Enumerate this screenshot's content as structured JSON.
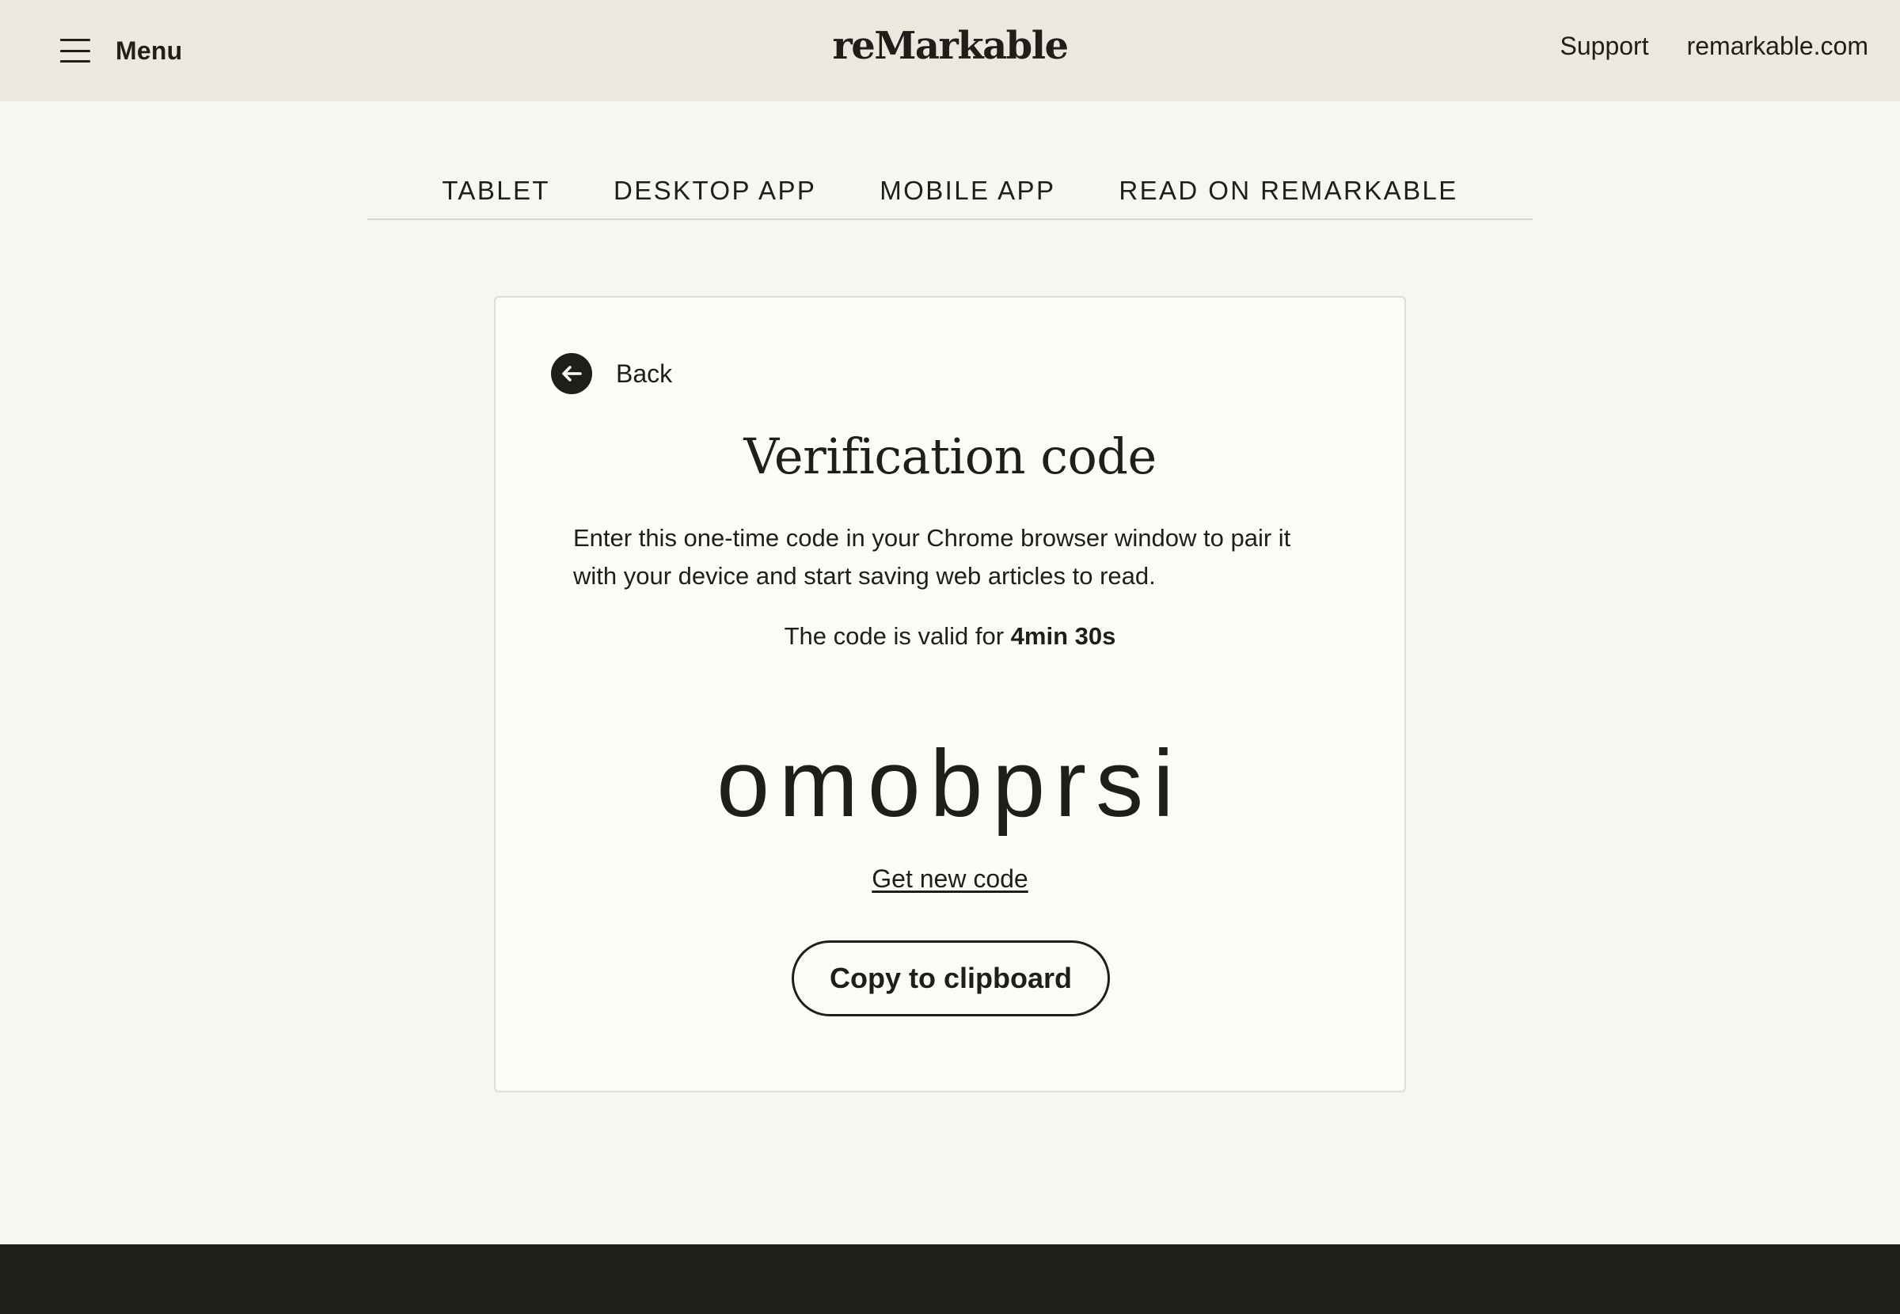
{
  "header": {
    "menu_label": "Menu",
    "logo_text": "reMarkable",
    "links": [
      "Support",
      "remarkable.com"
    ]
  },
  "tabs": [
    "TABLET",
    "DESKTOP APP",
    "MOBILE APP",
    "READ ON REMARKABLE"
  ],
  "card": {
    "back_label": "Back",
    "title": "Verification code",
    "description": "Enter this one-time code in your Chrome browser window to pair it with your device and start saving web articles to read.",
    "validity_prefix": "The code is valid for",
    "validity_time": "4min 30s",
    "code": "omobprsi",
    "new_code_link": "Get new code",
    "copy_button": "Copy to clipboard"
  },
  "icons": {
    "menu": "hamburger-menu-icon",
    "back": "arrow-left-circle-icon"
  },
  "colors": {
    "header_bg": "#ece8de",
    "page_bg": "#f8f6f1",
    "card_bg": "#fcfbf8",
    "text": "#1f1e1b",
    "footer_bg": "#1f1e1b"
  }
}
